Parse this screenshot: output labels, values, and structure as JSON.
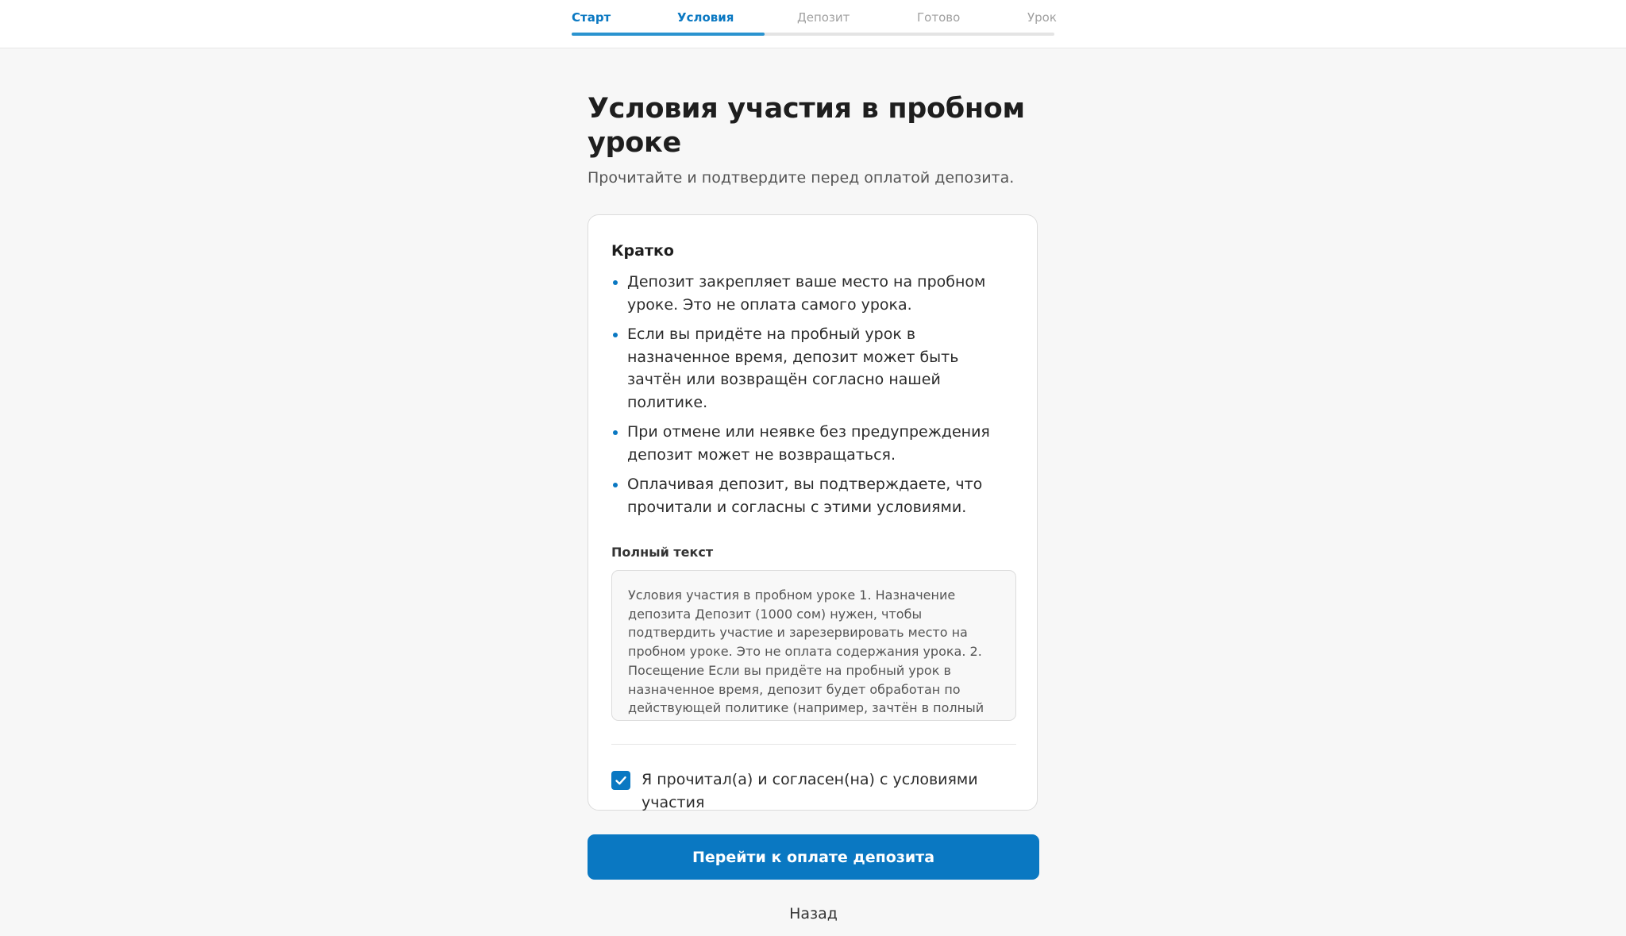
{
  "progress": {
    "steps": [
      {
        "label": "Старт",
        "state": "done"
      },
      {
        "label": "Условия",
        "state": "active"
      },
      {
        "label": "Депозит",
        "state": "pending"
      },
      {
        "label": "Готово",
        "state": "pending"
      },
      {
        "label": "Урок",
        "state": "pending"
      }
    ],
    "fraction_complete": 0.4
  },
  "header": {
    "title": "Условия участия в пробном уроке",
    "subtitle": "Прочитайте и подтвердите перед оплатой депозита."
  },
  "summary": {
    "title": "Кратко",
    "items": [
      "Депозит закрепляет ваше место на пробном уроке. Это не оплата самого урока.",
      "Если вы придёте на пробный урок в назначенное время, депозит может быть зачтён или возвращён согласно нашей политике.",
      "При отмене или неявке без предупреждения депозит может не возвращаться.",
      "Оплачивая депозит, вы подтверждаете, что прочитали и согласны с этими условиями."
    ]
  },
  "full_text": {
    "label": "Полный текст",
    "content": "Условия участия в пробном уроке 1. Назначение депозита Депозит (1000 сом) нужен, чтобы подтвердить участие и зарезервировать место на пробном уроке. Это не оплата содержания урока. 2. Посещение Если вы придёте на пробный урок в назначенное время, депозит будет обработан по действующей политике (например, зачтён в полный курс или возвращён, как описано в"
  },
  "agreement": {
    "label": "Я прочитал(а) и согласен(на) с условиями участия",
    "checked": true
  },
  "actions": {
    "primary_label": "Перейти к оплате депозита",
    "back_label": "Назад"
  },
  "colors": {
    "accent": "#0a78c2",
    "progress": "#2a93cf"
  }
}
